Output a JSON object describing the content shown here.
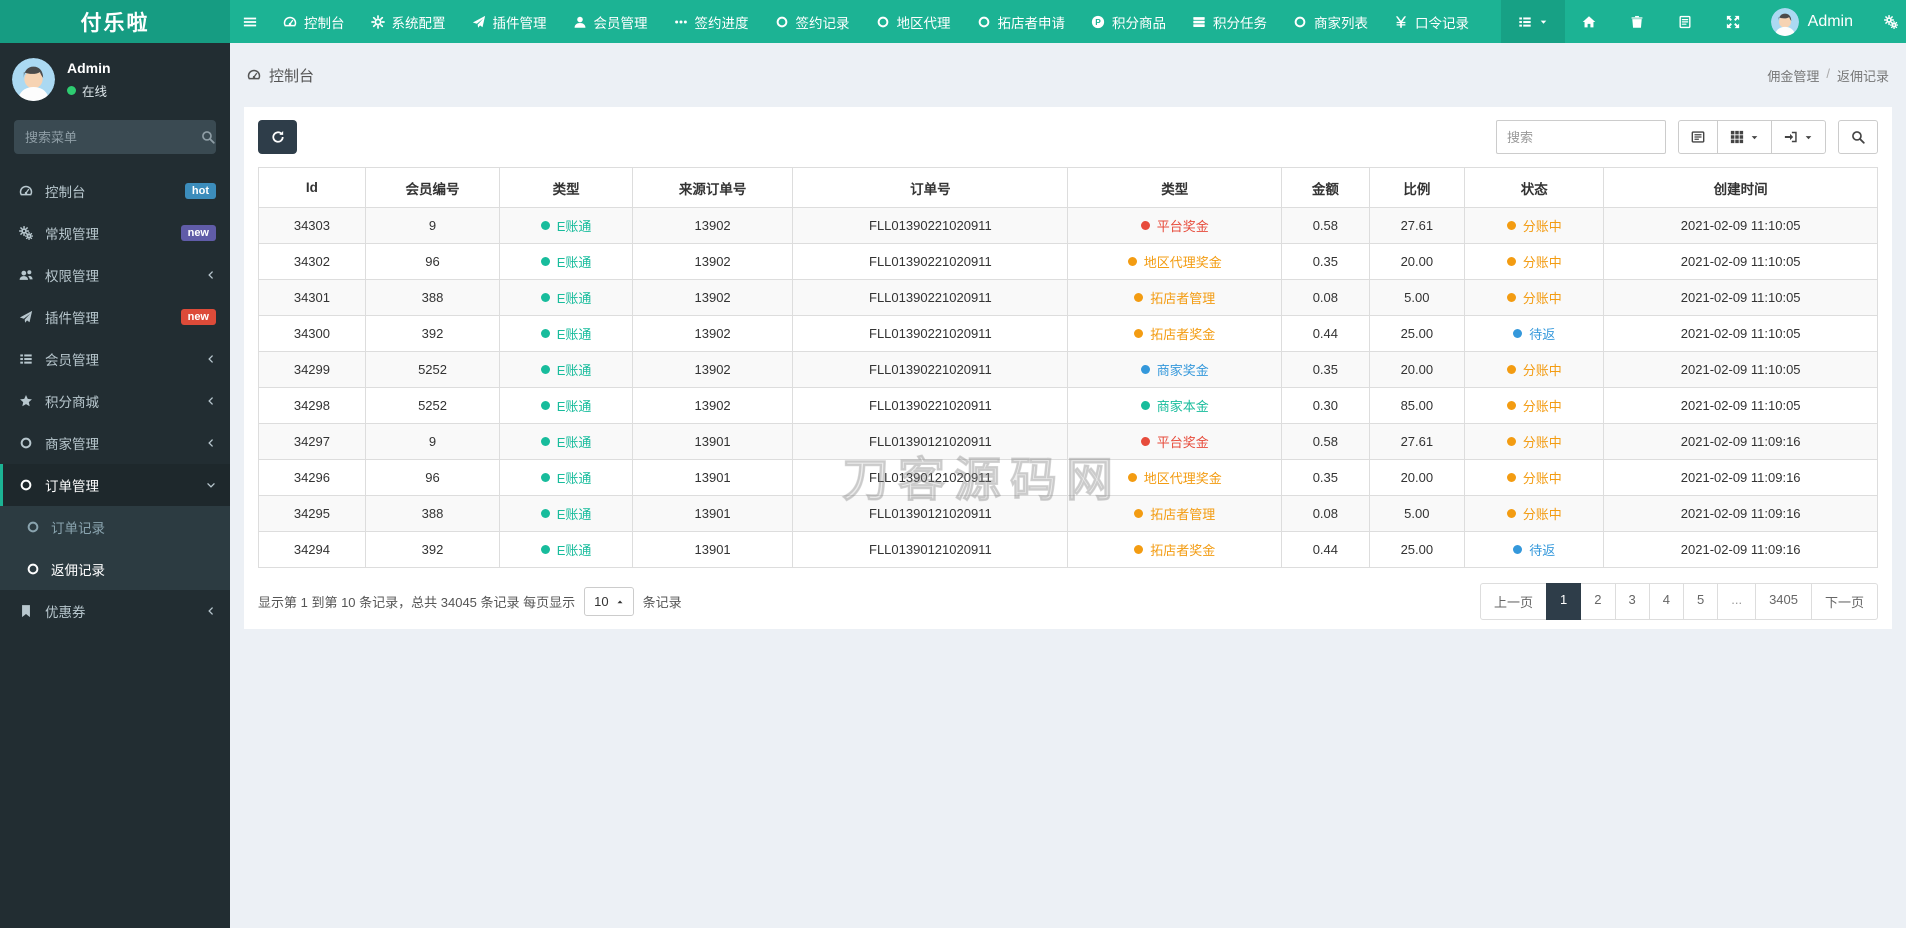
{
  "brand": "付乐啦",
  "colors": {
    "navbar": "#1cb394",
    "navbar_brand": "#169c82",
    "sidebar": "#222d32",
    "accent_teal": "#18bc9c",
    "red": "#e74c3c",
    "orange": "#f39c12",
    "blue": "#3498db",
    "dark_button": "#2e3d49",
    "badge_hot": "#3c8dbc",
    "badge_new_purple": "#605ca8",
    "badge_new_red": "#dd4b39"
  },
  "navbar": {
    "items": [
      {
        "icon": "gauge",
        "label": "控制台"
      },
      {
        "icon": "gear",
        "label": "系统配置"
      },
      {
        "icon": "plane",
        "label": "插件管理"
      },
      {
        "icon": "user",
        "label": "会员管理"
      },
      {
        "icon": "ellipsis",
        "label": "签约进度"
      },
      {
        "icon": "circle",
        "label": "签约记录"
      },
      {
        "icon": "circle",
        "label": "地区代理"
      },
      {
        "icon": "circle",
        "label": "拓店者申请"
      },
      {
        "icon": "circle-p",
        "label": "积分商品"
      },
      {
        "icon": "tasks",
        "label": "积分任务"
      },
      {
        "icon": "circle",
        "label": "商家列表"
      },
      {
        "icon": "yen",
        "label": "口令记录"
      }
    ],
    "user": {
      "name": "Admin"
    }
  },
  "sidebar": {
    "user": {
      "name": "Admin",
      "status": "在线"
    },
    "search_placeholder": "搜索菜单",
    "items": [
      {
        "icon": "gauge",
        "label": "控制台",
        "badge": {
          "text": "hot",
          "color": "#3c8dbc"
        }
      },
      {
        "icon": "gears",
        "label": "常规管理",
        "badge": {
          "text": "new",
          "color": "#605ca8"
        }
      },
      {
        "icon": "users",
        "label": "权限管理",
        "chevron": "left"
      },
      {
        "icon": "plane",
        "label": "插件管理",
        "badge": {
          "text": "new",
          "color": "#dd4b39"
        }
      },
      {
        "icon": "list",
        "label": "会员管理",
        "chevron": "left"
      },
      {
        "icon": "star",
        "label": "积分商城",
        "chevron": "left"
      },
      {
        "icon": "circle",
        "label": "商家管理",
        "chevron": "left"
      },
      {
        "icon": "circle",
        "label": "订单管理",
        "chevron": "down",
        "active": true,
        "children": [
          {
            "icon": "circle",
            "label": "订单记录"
          },
          {
            "icon": "circle",
            "label": "返佣记录",
            "active": true
          }
        ]
      },
      {
        "icon": "bookmark",
        "label": "优惠券",
        "chevron": "left"
      }
    ]
  },
  "content_header": {
    "title": "控制台",
    "breadcrumb": [
      "佣金管理",
      "返佣记录"
    ],
    "separator": "/"
  },
  "toolbar": {
    "search_placeholder": "搜索"
  },
  "table": {
    "columns": [
      "Id",
      "会员编号",
      "类型",
      "来源订单号",
      "订单号",
      "类型",
      "金额",
      "比例",
      "状态",
      "创建时间"
    ],
    "col_widths": [
      "6.6%",
      "8.3%",
      "8.2%",
      "9.9%",
      "17%",
      "13.2%",
      "5.4%",
      "5.9%",
      "8.6%",
      "16.9%"
    ],
    "rows": [
      {
        "id": "34303",
        "member": "9",
        "type": {
          "label": "E账通",
          "color": "#18bc9c"
        },
        "source": "13902",
        "order": "FLL01390221020911",
        "category": {
          "label": "平台奖金",
          "color": "#e74c3c"
        },
        "amount": "0.58",
        "ratio": "27.61",
        "status": {
          "label": "分账中",
          "color": "#f39c12"
        },
        "created": "2021-02-09 11:10:05"
      },
      {
        "id": "34302",
        "member": "96",
        "type": {
          "label": "E账通",
          "color": "#18bc9c"
        },
        "source": "13902",
        "order": "FLL01390221020911",
        "category": {
          "label": "地区代理奖金",
          "color": "#f39c12"
        },
        "amount": "0.35",
        "ratio": "20.00",
        "status": {
          "label": "分账中",
          "color": "#f39c12"
        },
        "created": "2021-02-09 11:10:05"
      },
      {
        "id": "34301",
        "member": "388",
        "type": {
          "label": "E账通",
          "color": "#18bc9c"
        },
        "source": "13902",
        "order": "FLL01390221020911",
        "category": {
          "label": "拓店者管理",
          "color": "#f39c12"
        },
        "amount": "0.08",
        "ratio": "5.00",
        "status": {
          "label": "分账中",
          "color": "#f39c12"
        },
        "created": "2021-02-09 11:10:05"
      },
      {
        "id": "34300",
        "member": "392",
        "type": {
          "label": "E账通",
          "color": "#18bc9c"
        },
        "source": "13902",
        "order": "FLL01390221020911",
        "category": {
          "label": "拓店者奖金",
          "color": "#f39c12"
        },
        "amount": "0.44",
        "ratio": "25.00",
        "status": {
          "label": "待返",
          "color": "#3498db"
        },
        "created": "2021-02-09 11:10:05"
      },
      {
        "id": "34299",
        "member": "5252",
        "type": {
          "label": "E账通",
          "color": "#18bc9c"
        },
        "source": "13902",
        "order": "FLL01390221020911",
        "category": {
          "label": "商家奖金",
          "color": "#3498db"
        },
        "amount": "0.35",
        "ratio": "20.00",
        "status": {
          "label": "分账中",
          "color": "#f39c12"
        },
        "created": "2021-02-09 11:10:05"
      },
      {
        "id": "34298",
        "member": "5252",
        "type": {
          "label": "E账通",
          "color": "#18bc9c"
        },
        "source": "13902",
        "order": "FLL01390221020911",
        "category": {
          "label": "商家本金",
          "color": "#18bc9c"
        },
        "amount": "0.30",
        "ratio": "85.00",
        "status": {
          "label": "分账中",
          "color": "#f39c12"
        },
        "created": "2021-02-09 11:10:05"
      },
      {
        "id": "34297",
        "member": "9",
        "type": {
          "label": "E账通",
          "color": "#18bc9c"
        },
        "source": "13901",
        "order": "FLL01390121020911",
        "category": {
          "label": "平台奖金",
          "color": "#e74c3c"
        },
        "amount": "0.58",
        "ratio": "27.61",
        "status": {
          "label": "分账中",
          "color": "#f39c12"
        },
        "created": "2021-02-09 11:09:16"
      },
      {
        "id": "34296",
        "member": "96",
        "type": {
          "label": "E账通",
          "color": "#18bc9c"
        },
        "source": "13901",
        "order": "FLL01390121020911",
        "category": {
          "label": "地区代理奖金",
          "color": "#f39c12"
        },
        "amount": "0.35",
        "ratio": "20.00",
        "status": {
          "label": "分账中",
          "color": "#f39c12"
        },
        "created": "2021-02-09 11:09:16"
      },
      {
        "id": "34295",
        "member": "388",
        "type": {
          "label": "E账通",
          "color": "#18bc9c"
        },
        "source": "13901",
        "order": "FLL01390121020911",
        "category": {
          "label": "拓店者管理",
          "color": "#f39c12"
        },
        "amount": "0.08",
        "ratio": "5.00",
        "status": {
          "label": "分账中",
          "color": "#f39c12"
        },
        "created": "2021-02-09 11:09:16"
      },
      {
        "id": "34294",
        "member": "392",
        "type": {
          "label": "E账通",
          "color": "#18bc9c"
        },
        "source": "13901",
        "order": "FLL01390121020911",
        "category": {
          "label": "拓店者奖金",
          "color": "#f39c12"
        },
        "amount": "0.44",
        "ratio": "25.00",
        "status": {
          "label": "待返",
          "color": "#3498db"
        },
        "created": "2021-02-09 11:09:16"
      }
    ]
  },
  "footer": {
    "summary_prefix": "显示第 1 到第 10 条记录，总共 34045 条记录 每页显示",
    "page_size": "10",
    "summary_suffix": "条记录",
    "pagination": [
      {
        "label": "上一页"
      },
      {
        "label": "1",
        "active": true
      },
      {
        "label": "2"
      },
      {
        "label": "3"
      },
      {
        "label": "4"
      },
      {
        "label": "5"
      },
      {
        "label": "...",
        "disabled": true
      },
      {
        "label": "3405"
      },
      {
        "label": "下一页"
      }
    ]
  },
  "watermark": "刀客源码网"
}
